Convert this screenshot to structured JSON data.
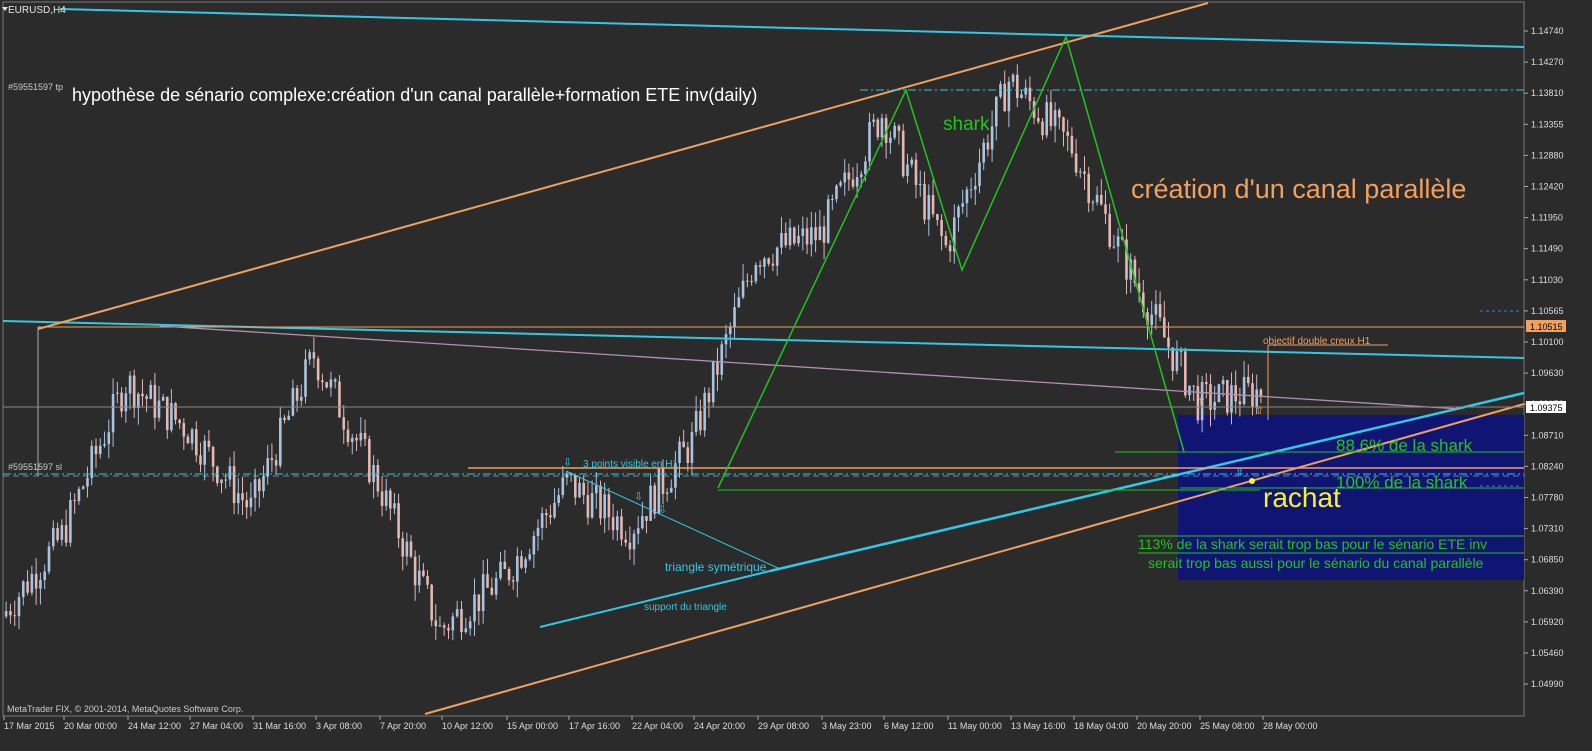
{
  "window": {
    "title": "EURUSD,H4"
  },
  "footer": {
    "copyright": "MetaTrader FIX, © 2001-2014, MetaQuotes Software Corp."
  },
  "colors": {
    "background": "#2b2b2b",
    "bull_candle": "#a9c3e0",
    "bear_candle": "#e3b7b2",
    "cyan": "#2ec9e6",
    "orange": "#f2a05d",
    "green": "#22c41f",
    "violet": "#b58fb2",
    "navy_box": "#101472",
    "yellow": "#f7f32a"
  },
  "annotations": {
    "title": "hypothèse de sénario complexe:création d'un canal parallèle+formation ETE inv(daily)",
    "tp_tag": "#59551597 tp",
    "sl_tag": "#59551597 sl",
    "shark": "shark",
    "canal": "création d'un canal parallèle",
    "objectif": "objectif double creux H1",
    "fib886": "88.6% de la shark",
    "fib100": "100% de la shark",
    "rachat": "rachat",
    "fib113": "113% de la shark serait trop bas pour le sénario ETE inv",
    "canal_low": "serait trop bas aussi pour le sénario du canal parallèle",
    "three_points": "3 points visible en H1",
    "triangle": "triangle symétrique",
    "support": "support du triangle"
  },
  "price_axis": {
    "ticks": [
      "1.14740",
      "1.14270",
      "1.13810",
      "1.13355",
      "1.12880",
      "1.12420",
      "1.11950",
      "1.11490",
      "1.11030",
      "1.10565",
      "1.10100",
      "1.09630",
      "1.09170",
      "1.08710",
      "1.08240",
      "1.07780",
      "1.07310",
      "1.06850",
      "1.06390",
      "1.05920",
      "1.05460",
      "1.04990"
    ],
    "current_price": "1.09375",
    "line_price": "1.10515"
  },
  "time_axis": {
    "labels": [
      "17 Mar 2015",
      "20 Mar 00:00",
      "24 Mar 12:00",
      "27 Mar 04:00",
      "31 Mar 16:00",
      "3 Apr 08:00",
      "7 Apr 20:00",
      "10 Apr 12:00",
      "15 Apr 00:00",
      "17 Apr 16:00",
      "22 Apr 04:00",
      "24 Apr 20:00",
      "29 Apr 08:00",
      "3 May 23:00",
      "6 May 12:00",
      "11 May 00:00",
      "13 May 16:00",
      "18 May 04:00",
      "20 May 20:00",
      "25 May 08:00",
      "28 May 00:00"
    ]
  },
  "chart_data": {
    "type": "candlestick",
    "symbol": "EURUSD",
    "timeframe": "H4",
    "ylim": [
      1.0499,
      1.1474
    ],
    "description_points": [
      {
        "label": "17 Mar 2015",
        "close": 1.06
      },
      {
        "label": "20 Mar 00:00",
        "close": 1.072
      },
      {
        "label": "24 Mar 12:00",
        "close": 1.095
      },
      {
        "label": "27 Mar 04:00",
        "close": 1.088
      },
      {
        "label": "31 Mar 16:00",
        "close": 1.076
      },
      {
        "label": "3 Apr 08:00",
        "close": 1.099
      },
      {
        "label": "7 Apr 20:00",
        "close": 1.08
      },
      {
        "label": "10 Apr 12:00",
        "close": 1.058
      },
      {
        "label": "15 Apr 00:00",
        "close": 1.066
      },
      {
        "label": "17 Apr 16:00",
        "close": 1.08
      },
      {
        "label": "22 Apr 04:00",
        "close": 1.073
      },
      {
        "label": "24 Apr 20:00",
        "close": 1.086
      },
      {
        "label": "29 Apr 08:00",
        "close": 1.114
      },
      {
        "label": "3 May 23:00",
        "close": 1.117
      },
      {
        "label": "6 May 12:00",
        "close": 1.135
      },
      {
        "label": "11 May 00:00",
        "close": 1.115
      },
      {
        "label": "13 May 16:00",
        "close": 1.14
      },
      {
        "label": "18 May 04:00",
        "close": 1.13
      },
      {
        "label": "20 May 20:00",
        "close": 1.11
      },
      {
        "label": "25 May 08:00",
        "close": 1.092
      },
      {
        "label": "28 May 00:00",
        "close": 1.0937
      }
    ]
  }
}
